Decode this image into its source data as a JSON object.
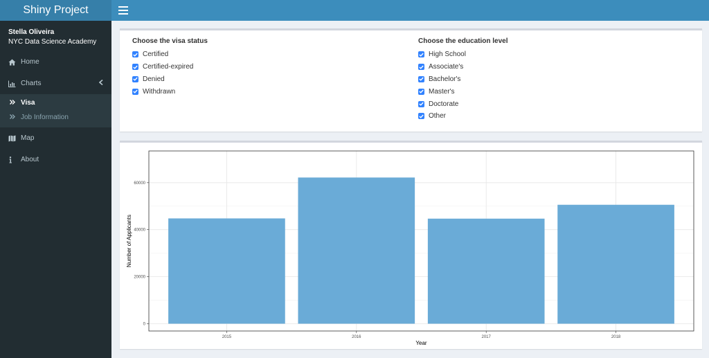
{
  "header": {
    "title": "Shiny Project"
  },
  "sidebar": {
    "user_name": "Stella Oliveira",
    "user_org": "NYC Data Science Academy",
    "items": [
      {
        "label": "Home",
        "icon": "home-icon"
      },
      {
        "label": "Charts",
        "icon": "bar-chart-icon"
      },
      {
        "label": "Map",
        "icon": "map-icon"
      },
      {
        "label": "About",
        "icon": "info-icon"
      }
    ],
    "subitems": [
      {
        "label": "Visa",
        "active": true
      },
      {
        "label": "Job Information",
        "active": false
      }
    ]
  },
  "filters": {
    "visa": {
      "title": "Choose the visa status",
      "options": [
        {
          "label": "Certified",
          "checked": true
        },
        {
          "label": "Certified-expired",
          "checked": true
        },
        {
          "label": "Denied",
          "checked": true
        },
        {
          "label": "Withdrawn",
          "checked": true
        }
      ]
    },
    "education": {
      "title": "Choose the education level",
      "options": [
        {
          "label": "High School",
          "checked": true
        },
        {
          "label": "Associate's",
          "checked": true
        },
        {
          "label": "Bachelor's",
          "checked": true
        },
        {
          "label": "Master's",
          "checked": true
        },
        {
          "label": "Doctorate",
          "checked": true
        },
        {
          "label": "Other",
          "checked": true
        }
      ]
    }
  },
  "colors": {
    "bar": "#6aabd7",
    "checkbox": "#3182ff",
    "header": "#3c8dbc",
    "sidebar": "#222d32"
  },
  "chart_data": {
    "type": "bar",
    "categories": [
      "2015",
      "2016",
      "2017",
      "2018"
    ],
    "values": [
      44800,
      62200,
      44700,
      50600
    ],
    "xlabel": "Year",
    "ylabel": "Number of Applicants",
    "yticks": [
      0,
      20000,
      40000,
      60000
    ],
    "ytick_labels": [
      "0",
      "20000",
      "40000",
      "60000"
    ],
    "ylim": [
      -3100,
      73500
    ],
    "grid": true
  }
}
